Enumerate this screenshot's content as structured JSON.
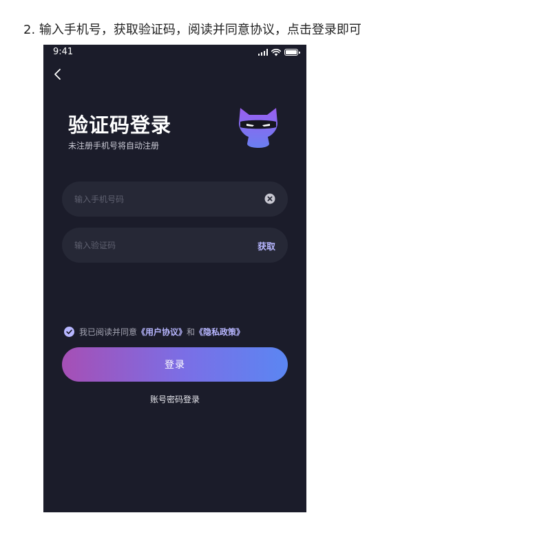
{
  "instruction": {
    "text": "2. 输入手机号，获取验证码，阅读并同意协议，点击登录即可"
  },
  "status_bar": {
    "time": "9:41",
    "icons": [
      "signal-icon",
      "wifi-icon",
      "battery-icon"
    ]
  },
  "nav": {
    "back_icon": "chevron-left-icon"
  },
  "header": {
    "title": "验证码登录",
    "subtitle": "未注册手机号将自动注册",
    "mascot": "cat-mascot-icon"
  },
  "form": {
    "phone": {
      "value": "",
      "placeholder": "输入手机号码",
      "clear_icon": "clear-icon"
    },
    "code": {
      "value": "",
      "placeholder": "输入验证码",
      "action_label": "获取"
    }
  },
  "agreement": {
    "checked": true,
    "prefix": "我已阅读并同意",
    "user_agreement": "《用户协议》",
    "conjunction": "和",
    "privacy_policy": "《隐私政策》"
  },
  "actions": {
    "login_label": "登录",
    "password_login_label": "账号密码登录"
  },
  "colors": {
    "phone_background": "#1b1c2a",
    "input_background": "#262836",
    "link_accent": "#b7b6ff",
    "checkbox": "#b7b6ff",
    "gradient_start": "#a64fb5",
    "gradient_end": "#5b86f2",
    "mascot_purple": "#8a55e6"
  }
}
